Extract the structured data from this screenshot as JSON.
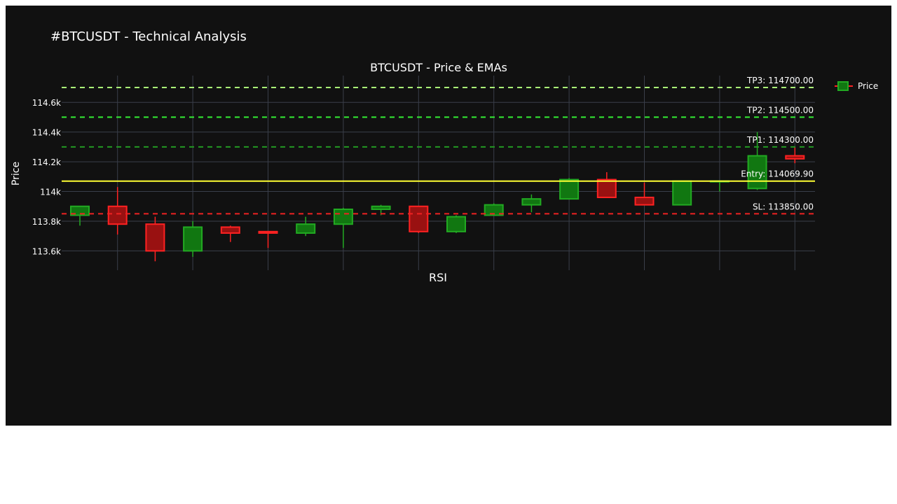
{
  "page_title": "#BTCUSDT - Technical Analysis",
  "chart_data": {
    "type": "candlestick",
    "title": "BTCUSDT - Price & EMAs",
    "ylabel": "Price",
    "xlabel": "RSI",
    "ylim": [
      113470,
      114780
    ],
    "yticks": [
      113600,
      113800,
      114000,
      114200,
      114400,
      114600
    ],
    "ytick_labels": [
      "113.6k",
      "113.8k",
      "114k",
      "114.2k",
      "114.4k",
      "114.6k"
    ],
    "grid": true,
    "legend": {
      "position": "top-right",
      "entries": [
        "Price"
      ]
    },
    "colors": {
      "up": "#22aa22",
      "down": "#ff2222",
      "background": "#111111",
      "grid": "#3a3f4a",
      "entry": "#ffff33"
    },
    "candles": [
      {
        "open": 113840,
        "high": 113900,
        "low": 113770,
        "close": 113900
      },
      {
        "open": 113900,
        "high": 114030,
        "low": 113710,
        "close": 113780
      },
      {
        "open": 113780,
        "high": 113830,
        "low": 113530,
        "close": 113600
      },
      {
        "open": 113600,
        "high": 113800,
        "low": 113560,
        "close": 113760
      },
      {
        "open": 113760,
        "high": 113770,
        "low": 113660,
        "close": 113720
      },
      {
        "open": 113730,
        "high": 113730,
        "low": 113620,
        "close": 113720
      },
      {
        "open": 113720,
        "high": 113830,
        "low": 113700,
        "close": 113780
      },
      {
        "open": 113780,
        "high": 113890,
        "low": 113620,
        "close": 113880
      },
      {
        "open": 113880,
        "high": 113910,
        "low": 113840,
        "close": 113900
      },
      {
        "open": 113900,
        "high": 113900,
        "low": 113720,
        "close": 113730
      },
      {
        "open": 113730,
        "high": 113840,
        "low": 113720,
        "close": 113830
      },
      {
        "open": 113840,
        "high": 113920,
        "low": 113840,
        "close": 113910
      },
      {
        "open": 113910,
        "high": 113980,
        "low": 113860,
        "close": 113950
      },
      {
        "open": 113950,
        "high": 114090,
        "low": 113950,
        "close": 114080
      },
      {
        "open": 114080,
        "high": 114130,
        "low": 113960,
        "close": 113960
      },
      {
        "open": 113960,
        "high": 114060,
        "low": 113910,
        "close": 113910
      },
      {
        "open": 113910,
        "high": 114070,
        "low": 113910,
        "close": 114070
      },
      {
        "open": 114070,
        "high": 114070,
        "low": 114000,
        "close": 114070
      },
      {
        "open": 114020,
        "high": 114400,
        "low": 114010,
        "close": 114240
      },
      {
        "open": 114240,
        "high": 114300,
        "low": 114190,
        "close": 114220
      }
    ],
    "levels": [
      {
        "label": "TP3: 114700.00",
        "value": 114700,
        "color": "#aaff77",
        "dash": "7,6"
      },
      {
        "label": "TP2: 114500.00",
        "value": 114500,
        "color": "#33ee33",
        "dash": "7,6"
      },
      {
        "label": "TP1: 114300.00",
        "value": 114300,
        "color": "#229922",
        "dash": "7,6"
      },
      {
        "label": "Entry: 114069.90",
        "value": 114069.9,
        "color": "#ffff33",
        "dash": ""
      },
      {
        "label": "SL: 113850.00",
        "value": 113850,
        "color": "#ee2222",
        "dash": "7,6"
      }
    ]
  }
}
